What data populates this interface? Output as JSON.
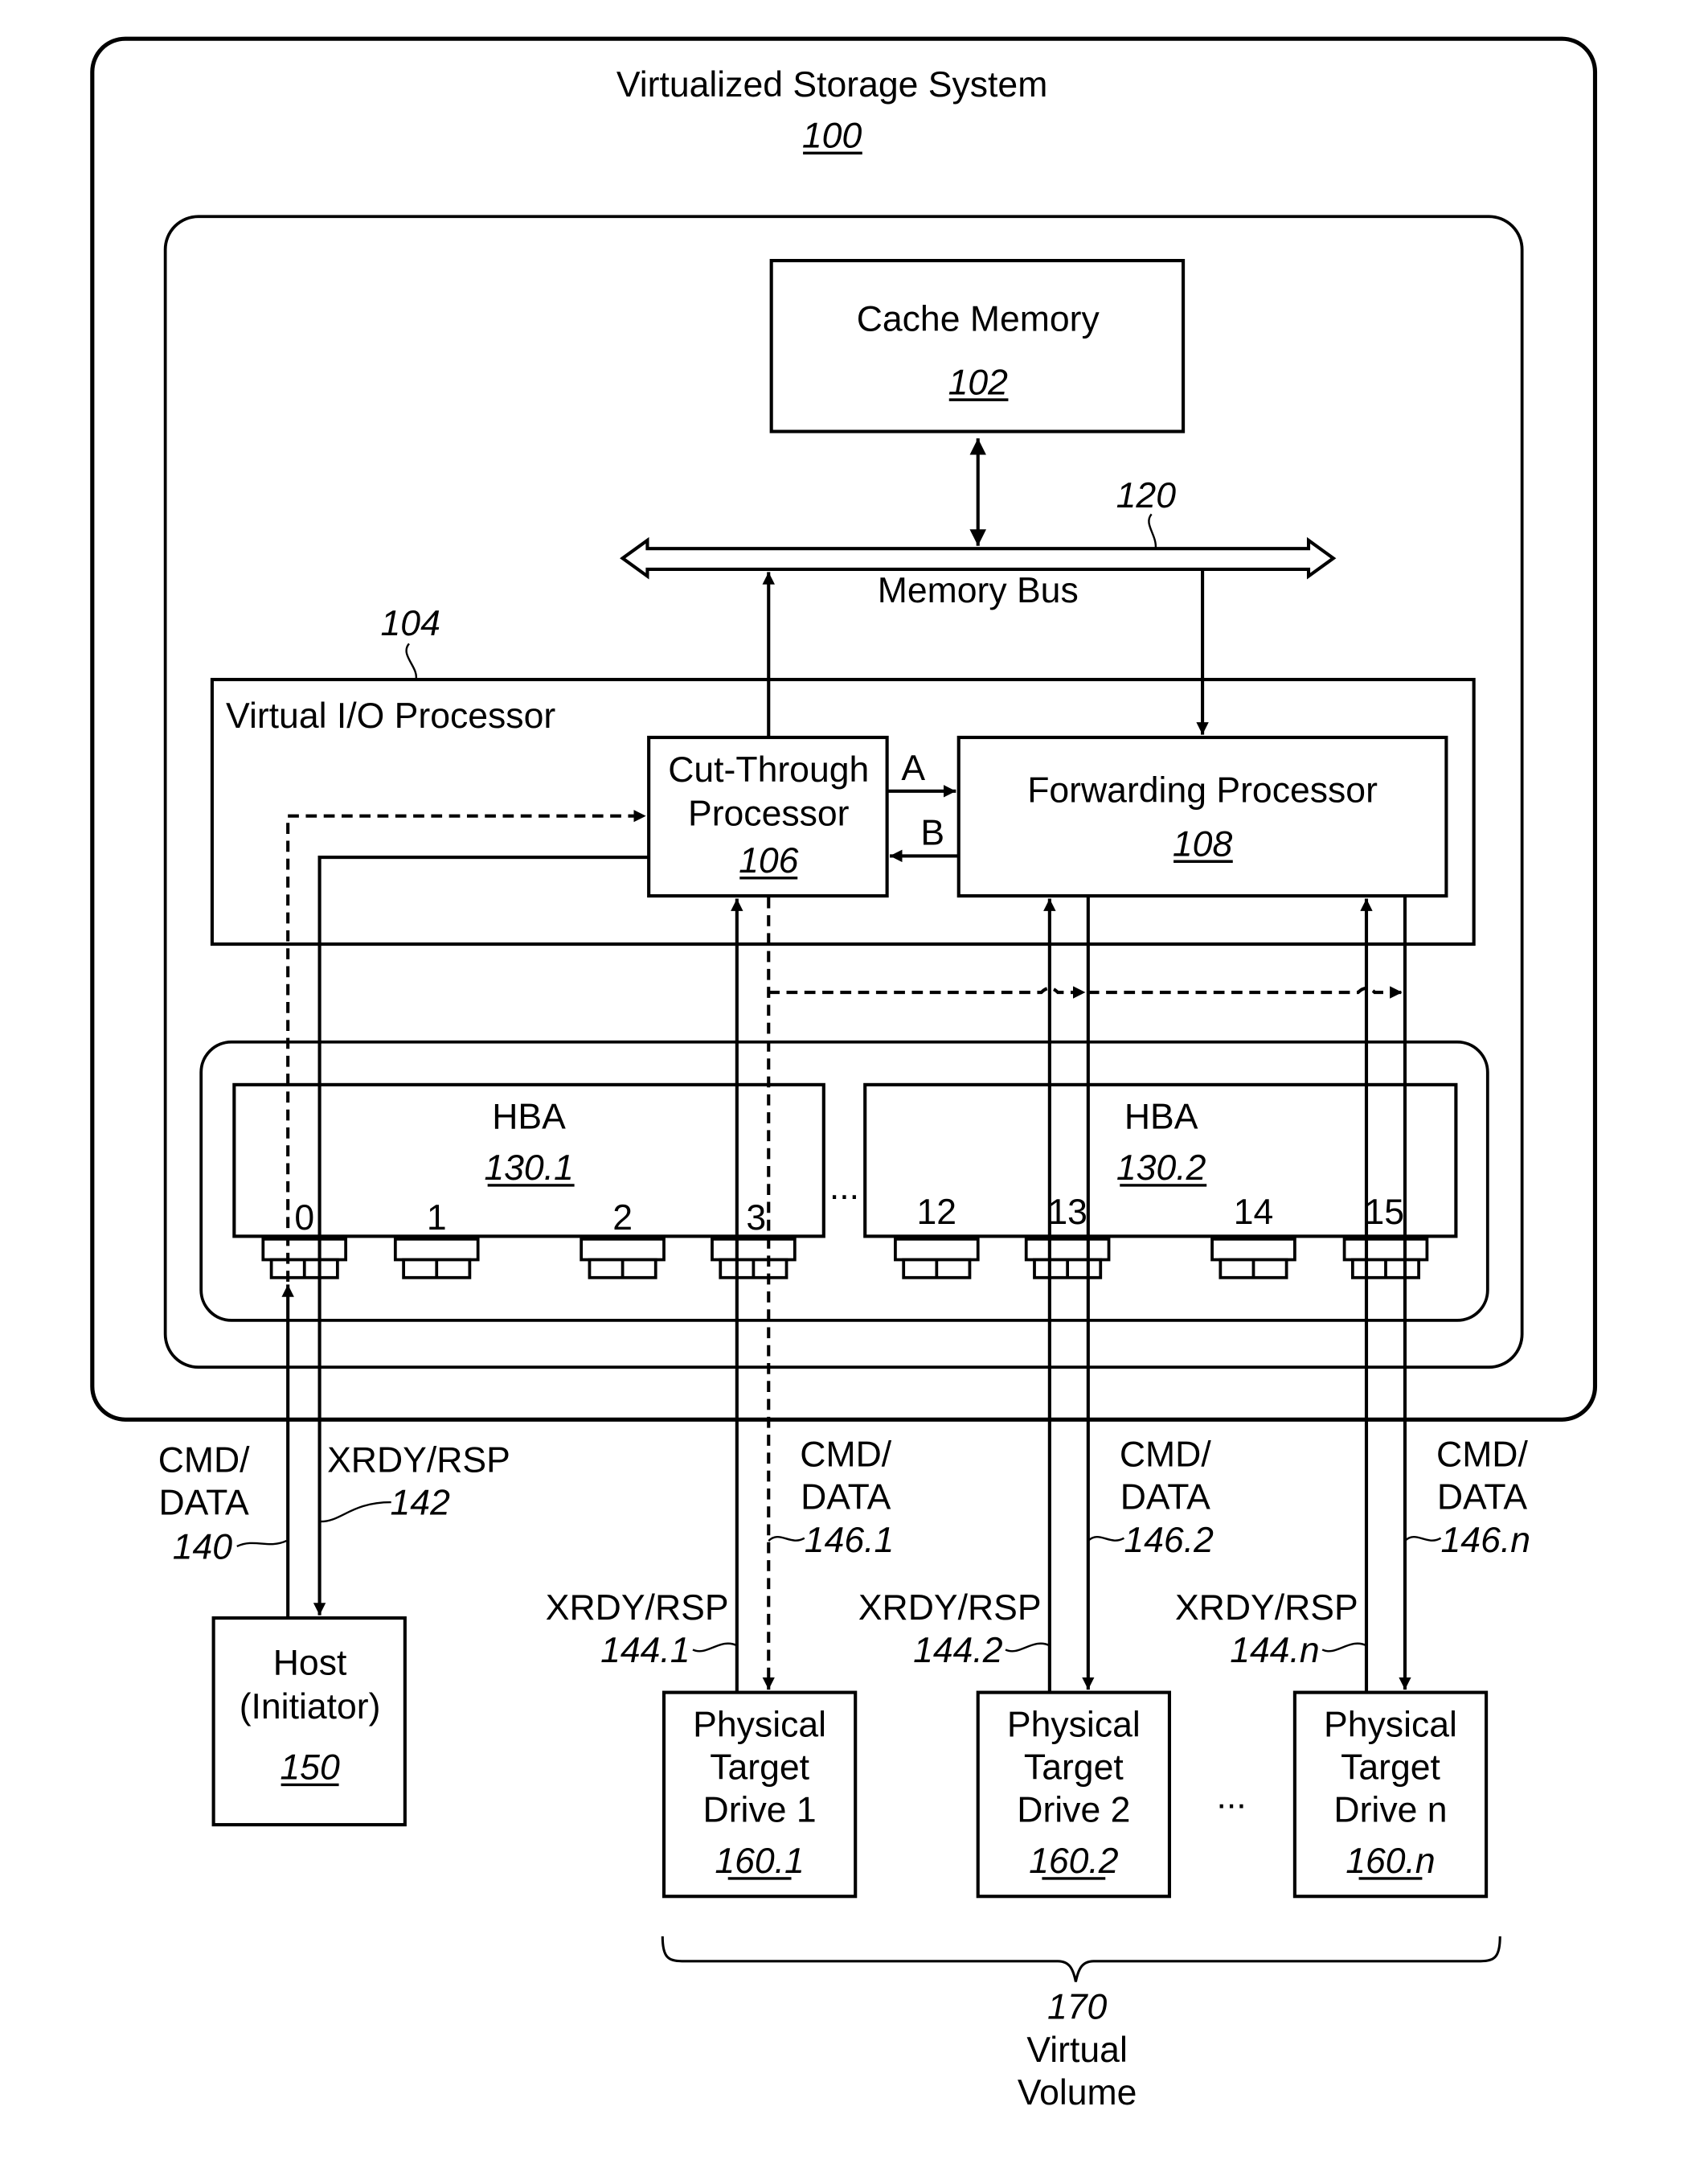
{
  "system": {
    "title": "Virtualized Storage System",
    "ref": "100"
  },
  "cache": {
    "title": "Cache Memory",
    "ref": "102"
  },
  "bus": {
    "title": "Memory Bus",
    "ref": "120"
  },
  "vio": {
    "title": "Virtual I/O Processor",
    "ref": "104"
  },
  "cut_through": {
    "line1": "Cut-Through",
    "line2": "Processor",
    "ref": "106"
  },
  "forwarding": {
    "title": "Forwarding Processor",
    "ref": "108"
  },
  "paths": {
    "a": "A",
    "b": "B"
  },
  "hba1": {
    "title": "HBA",
    "ref": "130.1",
    "ports": [
      "0",
      "1",
      "2",
      "3"
    ]
  },
  "hba2": {
    "title": "HBA",
    "ref": "130.2",
    "ports": [
      "12",
      "13",
      "14",
      "15"
    ]
  },
  "ellipsis": "...",
  "host": {
    "line1": "Host",
    "line2": "(Initiator)",
    "ref": "150"
  },
  "host_links": {
    "cmd_line1": "CMD/",
    "cmd_line2": "DATA",
    "cmd_ref": "140",
    "xrdy_label": "XRDY/RSP",
    "xrdy_ref": "142"
  },
  "drives": [
    {
      "line1": "Physical",
      "line2": "Target",
      "line3": "Drive 1",
      "ref": "160.1",
      "cmd_line1": "CMD/",
      "cmd_line2": "DATA",
      "cmd_ref": "146.1",
      "xrdy_label": "XRDY/RSP",
      "xrdy_ref": "144.1"
    },
    {
      "line1": "Physical",
      "line2": "Target",
      "line3": "Drive 2",
      "ref": "160.2",
      "cmd_line1": "CMD/",
      "cmd_line2": "DATA",
      "cmd_ref": "146.2",
      "xrdy_label": "XRDY/RSP",
      "xrdy_ref": "144.2"
    },
    {
      "line1": "Physical",
      "line2": "Target",
      "line3": "Drive n",
      "ref": "160.n",
      "cmd_line1": "CMD/",
      "cmd_line2": "DATA",
      "cmd_ref": "146.n",
      "xrdy_label": "XRDY/RSP",
      "xrdy_ref": "144.n"
    }
  ],
  "drive_ellipsis": "...",
  "volume": {
    "ref": "170",
    "line1": "Virtual",
    "line2": "Volume"
  }
}
